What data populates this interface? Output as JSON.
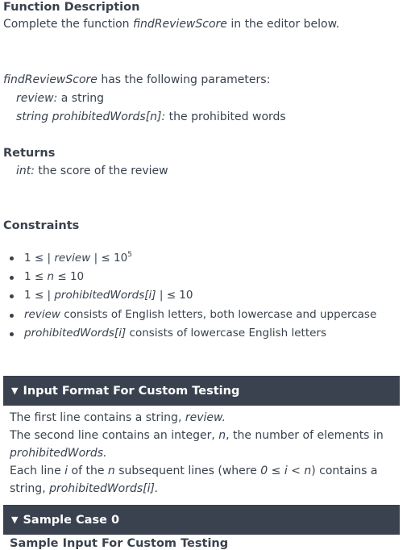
{
  "function_description": {
    "heading": "Function Description",
    "intro_prefix": "Complete the function ",
    "function_name": "findReviewScore",
    "intro_suffix": " in the editor below."
  },
  "parameters": {
    "function_name": "findReviewScore",
    "intro_suffix": " has the following parameters:",
    "items": [
      {
        "name": "review:",
        "desc": " a string"
      },
      {
        "name": "string prohibitedWords[n]:",
        "desc": " the prohibited words"
      }
    ]
  },
  "returns": {
    "heading": "Returns",
    "type": "int:",
    "desc": " the score of the review"
  },
  "constraints": {
    "heading": "Constraints",
    "items": [
      {
        "a": "1 ≤ | ",
        "b": "review",
        "c": " | ≤ 10",
        "sup": "5"
      },
      {
        "a": "1 ≤ ",
        "b": "n",
        "c": " ≤ 10",
        "sup": ""
      },
      {
        "a": "1 ≤ | ",
        "b": "prohibitedWords[i]",
        "c": " | ≤ 10",
        "sup": ""
      },
      {
        "a": "",
        "b": "review",
        "c": " consists of English letters, both lowercase and uppercase",
        "sup": ""
      },
      {
        "a": "",
        "b": "prohibitedWords[i]",
        "c": " consists of lowercase English letters",
        "sup": ""
      }
    ]
  },
  "input_format": {
    "toggle": "▼",
    "heading": "Input Format For Custom Testing",
    "l1_a": "The first line contains a string, ",
    "l1_b": "review.",
    "l2_a": "The second line contains an integer, ",
    "l2_b": "n",
    "l2_c": ", the number of elements in",
    "l3": "prohibitedWords.",
    "l4_a": "Each line ",
    "l4_b": "i",
    "l4_c": " of the ",
    "l4_d": "n",
    "l4_e": " subsequent lines (where ",
    "l4_f": "0 ≤ i < n",
    "l4_g": ") contains a",
    "l5_a": "string, ",
    "l5_b": "prohibitedWords[i]."
  },
  "sample_case": {
    "toggle": "▼",
    "heading": "Sample Case 0",
    "next_heading": "Sample Input For Custom Testing"
  },
  "colors": {
    "text": "#39424e",
    "bar": "#39424e",
    "bar_text": "#ffffff"
  }
}
